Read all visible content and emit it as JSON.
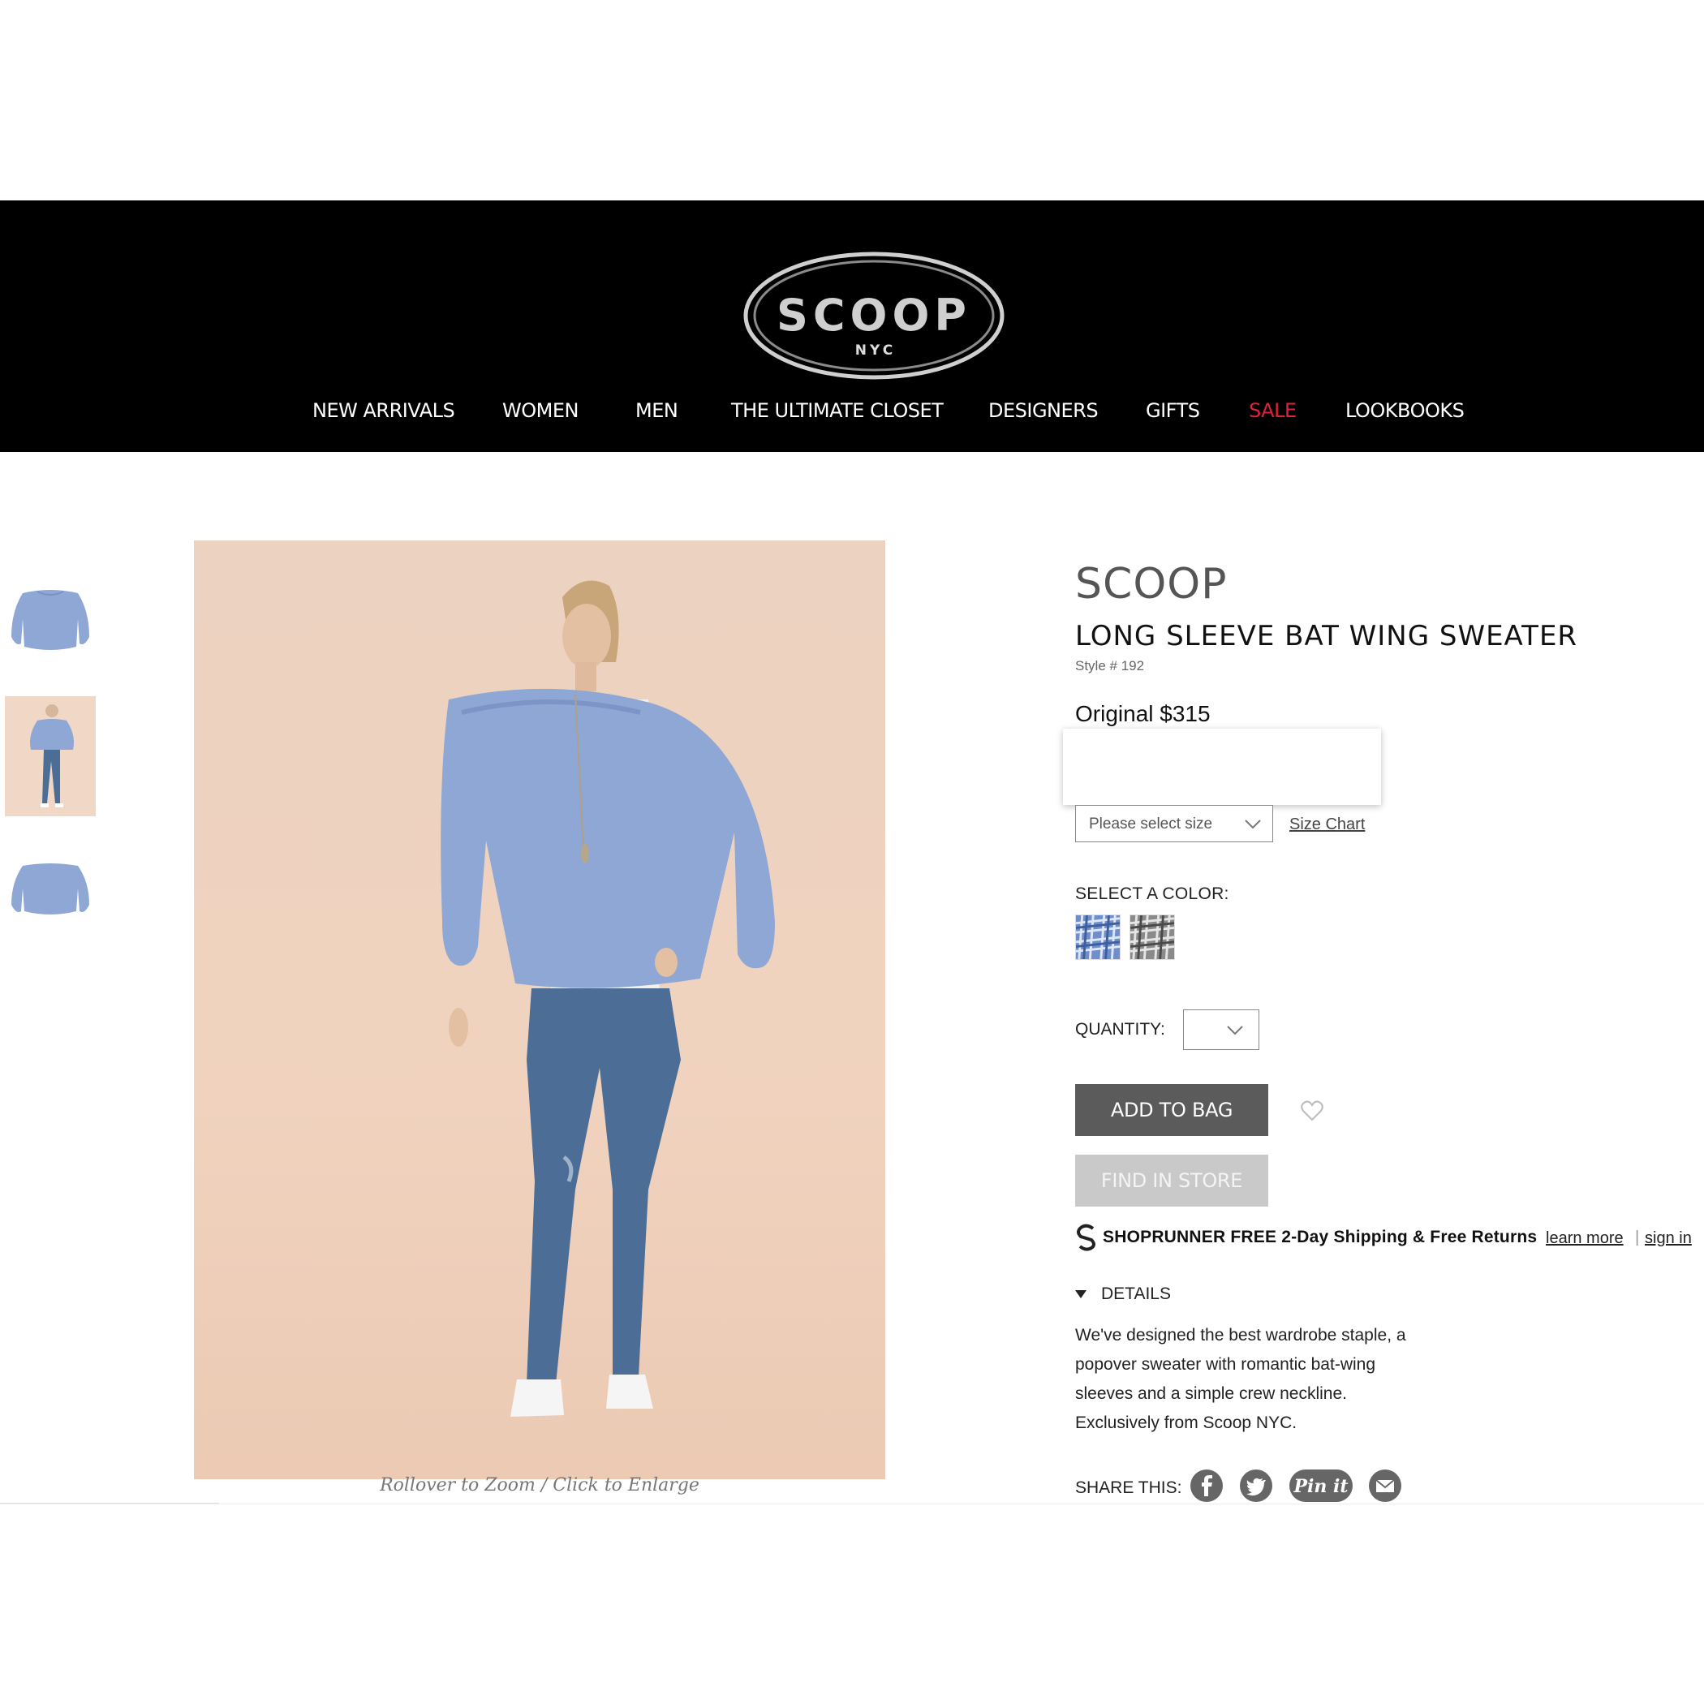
{
  "logo": {
    "brand": "SCOOP",
    "sub": "NYC"
  },
  "nav": [
    {
      "label": "NEW ARRIVALS"
    },
    {
      "label": "WOMEN"
    },
    {
      "label": "MEN"
    },
    {
      "label": "THE ULTIMATE CLOSET"
    },
    {
      "label": "DESIGNERS"
    },
    {
      "label": "GIFTS"
    },
    {
      "label": "SALE"
    },
    {
      "label": "LOOKBOOKS"
    }
  ],
  "gallery": {
    "caption": "Rollover to Zoom / Click to Enlarge"
  },
  "product": {
    "brand": "SCOOP",
    "name": "LONG SLEEVE BAT WING SWEATER",
    "style": "Style # 192",
    "price": "Original $315",
    "size_placeholder": "Please select size",
    "size_chart": "Size Chart",
    "color_label": "SELECT A COLOR:",
    "quantity_label": "QUANTITY:",
    "add_to_bag": "ADD TO BAG",
    "find_in_store": "FIND IN STORE"
  },
  "shoprunner": {
    "text": "SHOPRUNNER FREE 2-Day Shipping & Free Returns",
    "learn_more": "learn more",
    "separator": "|",
    "sign_in": "sign in"
  },
  "details": {
    "toggle": "DETAILS",
    "lines": [
      "We've designed the best wardrobe staple, a",
      "popover sweater with romantic bat-wing",
      "sleeves and a simple crew neckline.",
      "Exclusively from Scoop NYC."
    ]
  },
  "share": {
    "label": "SHARE THIS:",
    "pin_text": "Pin it"
  },
  "colors": {
    "header_bg": "#000000",
    "sale": "#e0213b",
    "sweater": "#8fa7d4",
    "add_button": "#5b5b5b",
    "find_button": "#c9c9c9"
  }
}
